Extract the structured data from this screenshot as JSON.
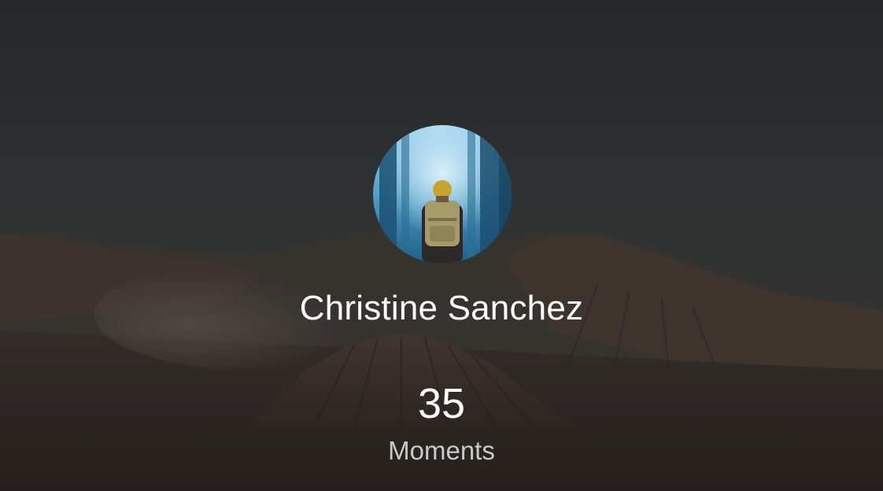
{
  "profile": {
    "name": "Christine Sanchez",
    "avatar_icon": "hiker-photo-avatar"
  },
  "stats": {
    "count": "35",
    "label": "Moments"
  },
  "background": {
    "icon": "volcano-landscape-photo",
    "tint": "#2b2c2c"
  }
}
